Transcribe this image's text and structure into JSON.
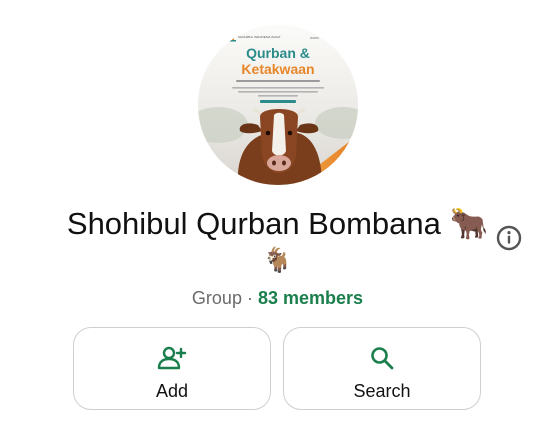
{
  "group": {
    "name_line1": "Shohibul Qurban Bombana 🐂",
    "name_line2": "🐐",
    "type_label": "Group",
    "separator": "·",
    "members_label": "83 members"
  },
  "avatar": {
    "poster_title_1": "Qurban &",
    "poster_title_2": "Ketakwaan",
    "org_text": "SHOHIBUL INDONESIA ZAKAT",
    "web_text": "www."
  },
  "actions": [
    {
      "label": "Add",
      "icon": "add-person-icon"
    },
    {
      "label": "Search",
      "icon": "search-icon"
    }
  ],
  "colors": {
    "accent_green": "#1b7f4d",
    "poster_teal": "#2a8c8a",
    "poster_orange": "#e8862a",
    "text_primary": "#111111",
    "text_secondary": "#6b6b6b"
  }
}
